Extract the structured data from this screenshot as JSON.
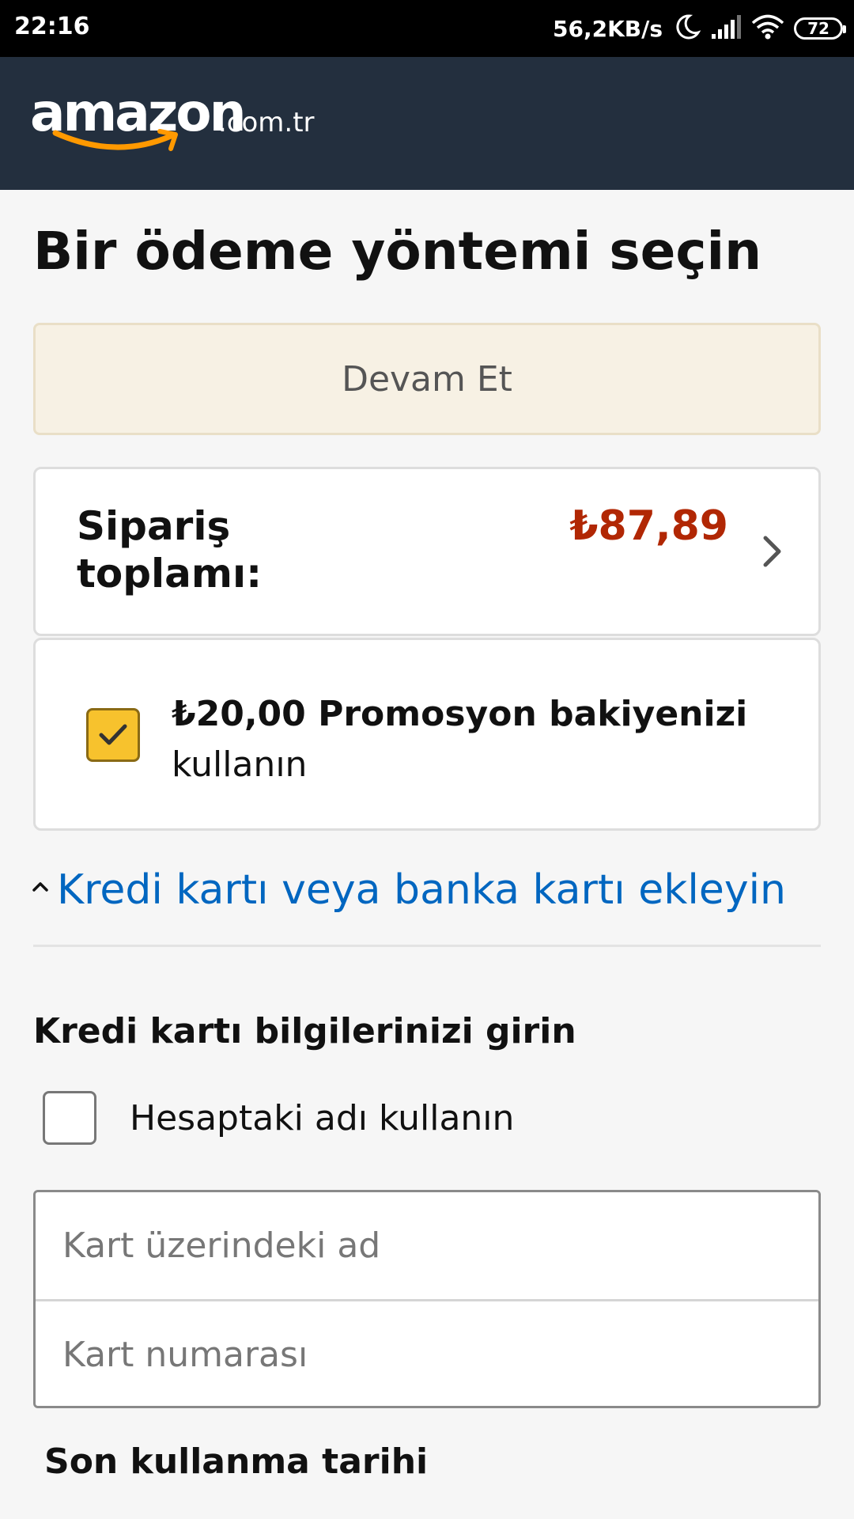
{
  "status_bar": {
    "time": "22:16",
    "network_speed": "56,2KB/s",
    "battery_level": "72",
    "icons": [
      "moon-icon",
      "signal-icon",
      "wifi-icon",
      "battery-icon"
    ]
  },
  "header": {
    "logo_word": "amazon",
    "logo_tld": ".com.tr",
    "logo_smile_color": "#f90",
    "background_color": "#232f3e"
  },
  "page": {
    "title": "Bir ödeme yöntemi seçin",
    "continue_label": "Devam Et"
  },
  "order_summary": {
    "label": "Sipariş toplamı:",
    "amount": "₺87,89",
    "amount_color": "#b12704"
  },
  "promo": {
    "checked": true,
    "amount_text": "₺20,00 Promosyon bakiyenizi",
    "suffix_text": "kullanın",
    "checkbox_color": "#f7c22d"
  },
  "add_card": {
    "link_label": "Kredi kartı veya banka kartı ekleyin",
    "link_color": "#0066c0"
  },
  "card_form": {
    "section_title": "Kredi kartı bilgilerinizi girin",
    "use_account_name_label": "Hesaptaki adı kullanın",
    "use_account_name_checked": false,
    "name_placeholder": "Kart üzerindeki ad",
    "name_value": "",
    "number_placeholder": "Kart numarası",
    "number_value": "",
    "expiry_title": "Son kullanma tarihi"
  }
}
